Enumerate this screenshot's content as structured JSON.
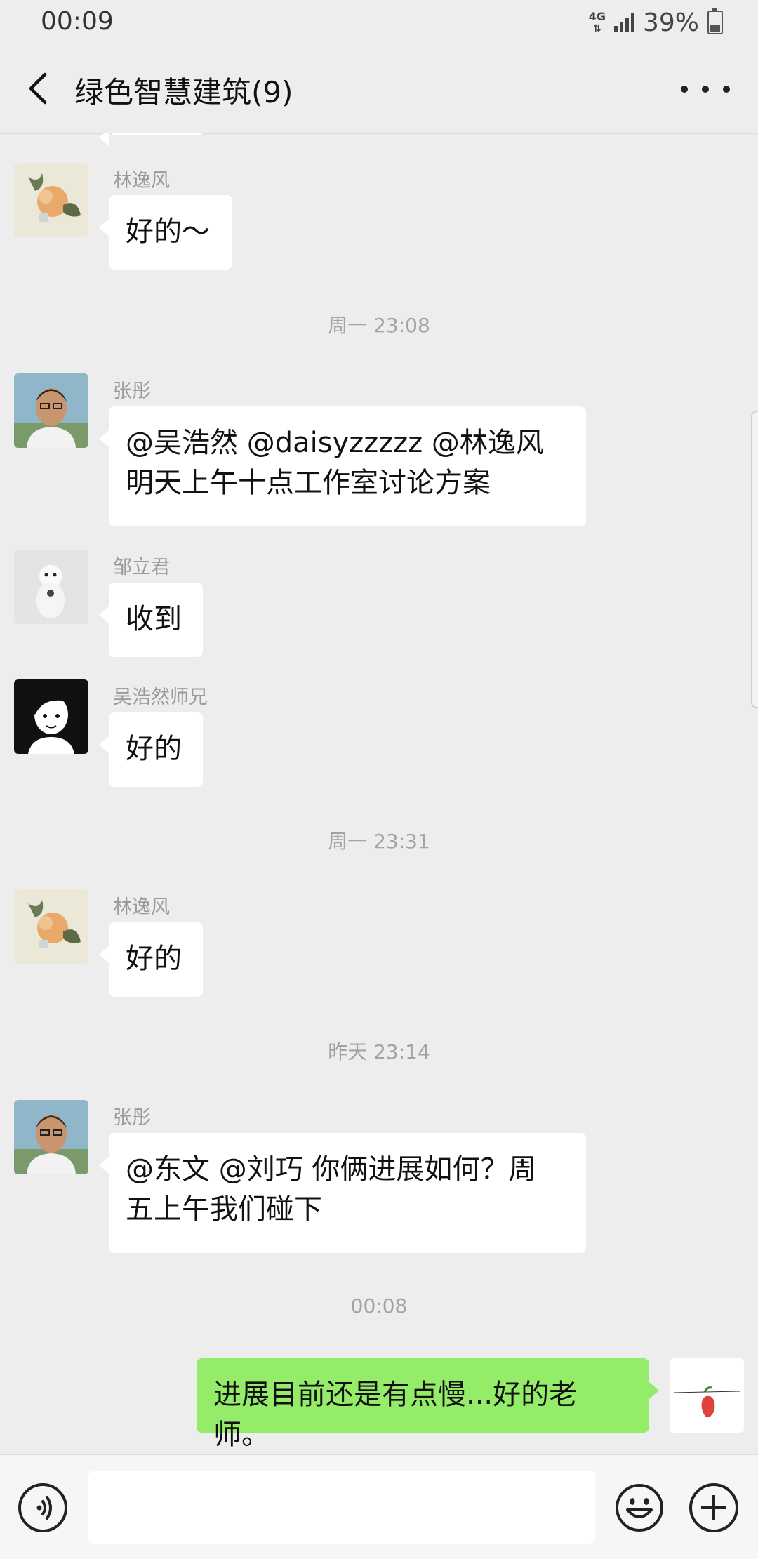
{
  "status": {
    "time": "00:09",
    "network": "4G",
    "battery": "39%"
  },
  "header": {
    "title": "绿色智慧建筑(9)"
  },
  "messages": [
    {
      "sender": "林逸风",
      "text": "好的～"
    },
    {
      "time": "周一 23:08"
    },
    {
      "sender": "张彤",
      "text": "@吴浩然 @daisyzzzzz @林逸风\n明天上午十点工作室讨论方案"
    },
    {
      "sender": "邹立君",
      "text": "收到"
    },
    {
      "sender": "吴浩然师兄",
      "text": "好的"
    },
    {
      "time": "周一 23:31"
    },
    {
      "sender": "林逸风",
      "text": "好的"
    },
    {
      "time": "昨天 23:14"
    },
    {
      "sender": "张彤",
      "text": "@东文  @刘巧  你俩进展如何？周\n五上午我们碰下"
    },
    {
      "time": "00:08"
    },
    {
      "sender": "me",
      "text": "进展目前还是有点慢...好的老师。"
    }
  ],
  "input": {
    "placeholder": ""
  },
  "colors": {
    "background": "#ededed",
    "bubble_other": "#ffffff",
    "bubble_me": "#95ec69"
  },
  "icons": [
    "back-arrow-icon",
    "more-icon",
    "voice-icon",
    "emoji-icon",
    "plus-icon"
  ]
}
